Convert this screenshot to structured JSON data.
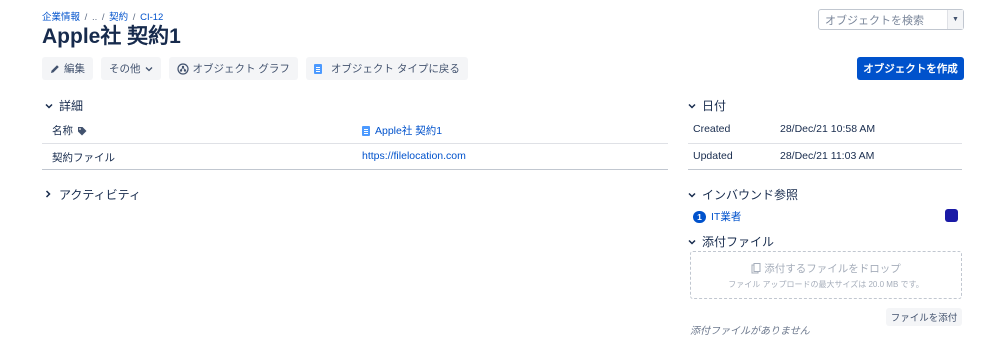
{
  "breadcrumb": {
    "items": [
      "企業情報",
      "..",
      "契約",
      "CI-12"
    ],
    "sep": "/"
  },
  "page_title": "Apple社 契約1",
  "search": {
    "placeholder": "オブジェクトを検索"
  },
  "toolbar": {
    "edit_label": "編集",
    "more_label": "その他",
    "graph_label": "オブジェクト グラフ",
    "back_label": "オブジェクト タイプに戻る"
  },
  "create_button": "オブジェクトを作成",
  "details": {
    "title": "詳細",
    "rows": [
      {
        "label": "名称",
        "value": "Apple社 契約1"
      },
      {
        "label": "契約ファイル",
        "value": "https://filelocation.com"
      }
    ]
  },
  "activity": {
    "title": "アクティビティ"
  },
  "dates": {
    "title": "日付",
    "rows": [
      {
        "label": "Created",
        "value": "28/Dec/21 10:58 AM"
      },
      {
        "label": "Updated",
        "value": "28/Dec/21 11:03 AM"
      }
    ]
  },
  "inbound": {
    "title": "インバウンド参照",
    "items": [
      {
        "count": "1",
        "label": "IT業者",
        "color": "#1a1aa6"
      }
    ]
  },
  "attachments": {
    "title": "添付ファイル",
    "drop_title": "添付するファイルをドロップ",
    "drop_sub": "ファイル アップロードの最大サイズは 20.0 MB です。",
    "attach_button": "ファイルを添付",
    "empty_text": "添付ファイルがありません"
  },
  "colors": {
    "primary": "#0052cc",
    "text": "#172b4d",
    "muted": "#5e6c84"
  },
  "icons": [
    "pencil-icon",
    "chevron-down-icon",
    "graph-icon",
    "file-icon",
    "tag-icon",
    "chevron-right-icon",
    "attachment-icon"
  ]
}
